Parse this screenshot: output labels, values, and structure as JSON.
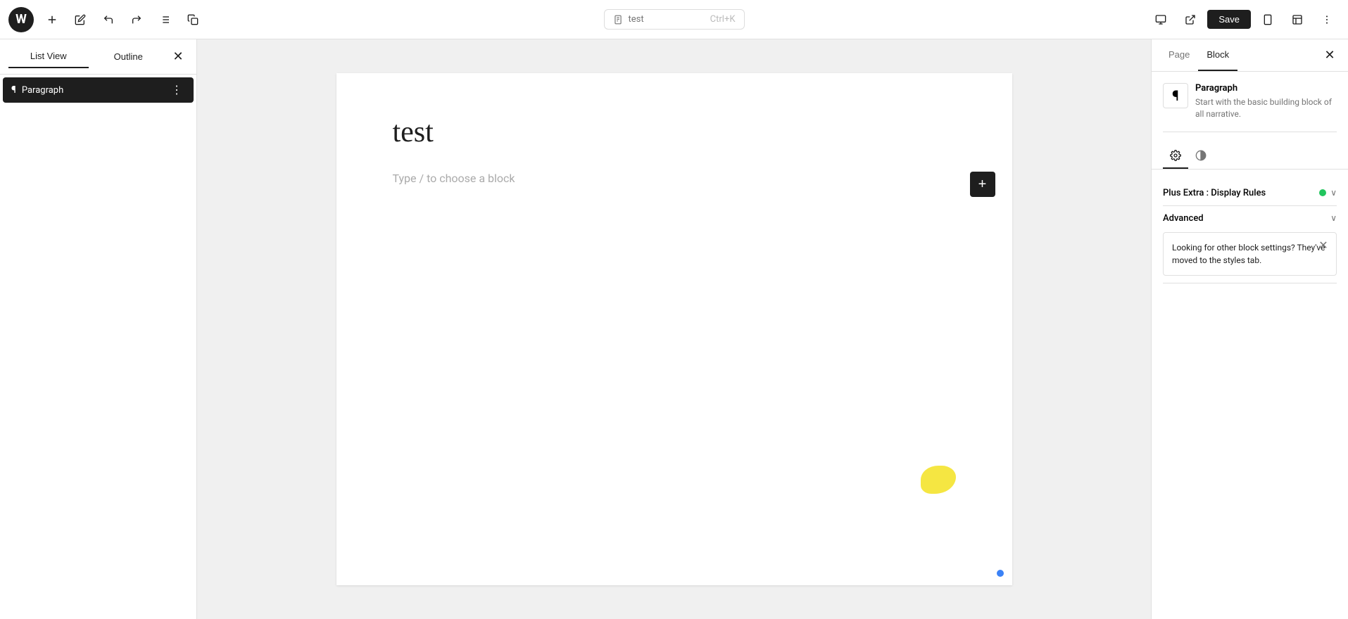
{
  "toolbar": {
    "wp_logo": "W",
    "add_label": "+",
    "edit_label": "✎",
    "undo_label": "↩",
    "redo_label": "↪",
    "list_view_label": "☰",
    "copy_label": "⎘",
    "command_palette_text": "test",
    "command_palette_shortcut": "Ctrl+K",
    "view_label": "⊡",
    "external_label": "↗",
    "save_label": "Save",
    "mobile_label": "📱",
    "template_label": "⊞",
    "more_label": "⋮"
  },
  "left_panel": {
    "tab1": "List View",
    "tab2": "Outline",
    "close_label": "✕",
    "items": [
      {
        "icon": "¶",
        "label": "Paragraph",
        "active": true
      }
    ]
  },
  "editor": {
    "title": "test",
    "placeholder": "Type / to choose a block",
    "add_block_label": "+"
  },
  "right_panel": {
    "tab_page": "Page",
    "tab_block": "Block",
    "close_label": "✕",
    "block_info": {
      "icon": "¶",
      "title": "Paragraph",
      "description": "Start with the basic building block of all narrative."
    },
    "settings_icon": "⚙",
    "styles_icon": "◑",
    "display_rules_label": "Plus Extra : Display Rules",
    "advanced_label": "Advanced",
    "notification": {
      "text": "Looking for other block settings? They've moved to the styles tab.",
      "close_label": "✕"
    },
    "chevron_label": "∨"
  },
  "colors": {
    "active_bg": "#1e1e1e",
    "accent": "#1e1e1e",
    "green": "#22c55e",
    "blue": "#3b82f6",
    "yellow": "#f5e642"
  }
}
